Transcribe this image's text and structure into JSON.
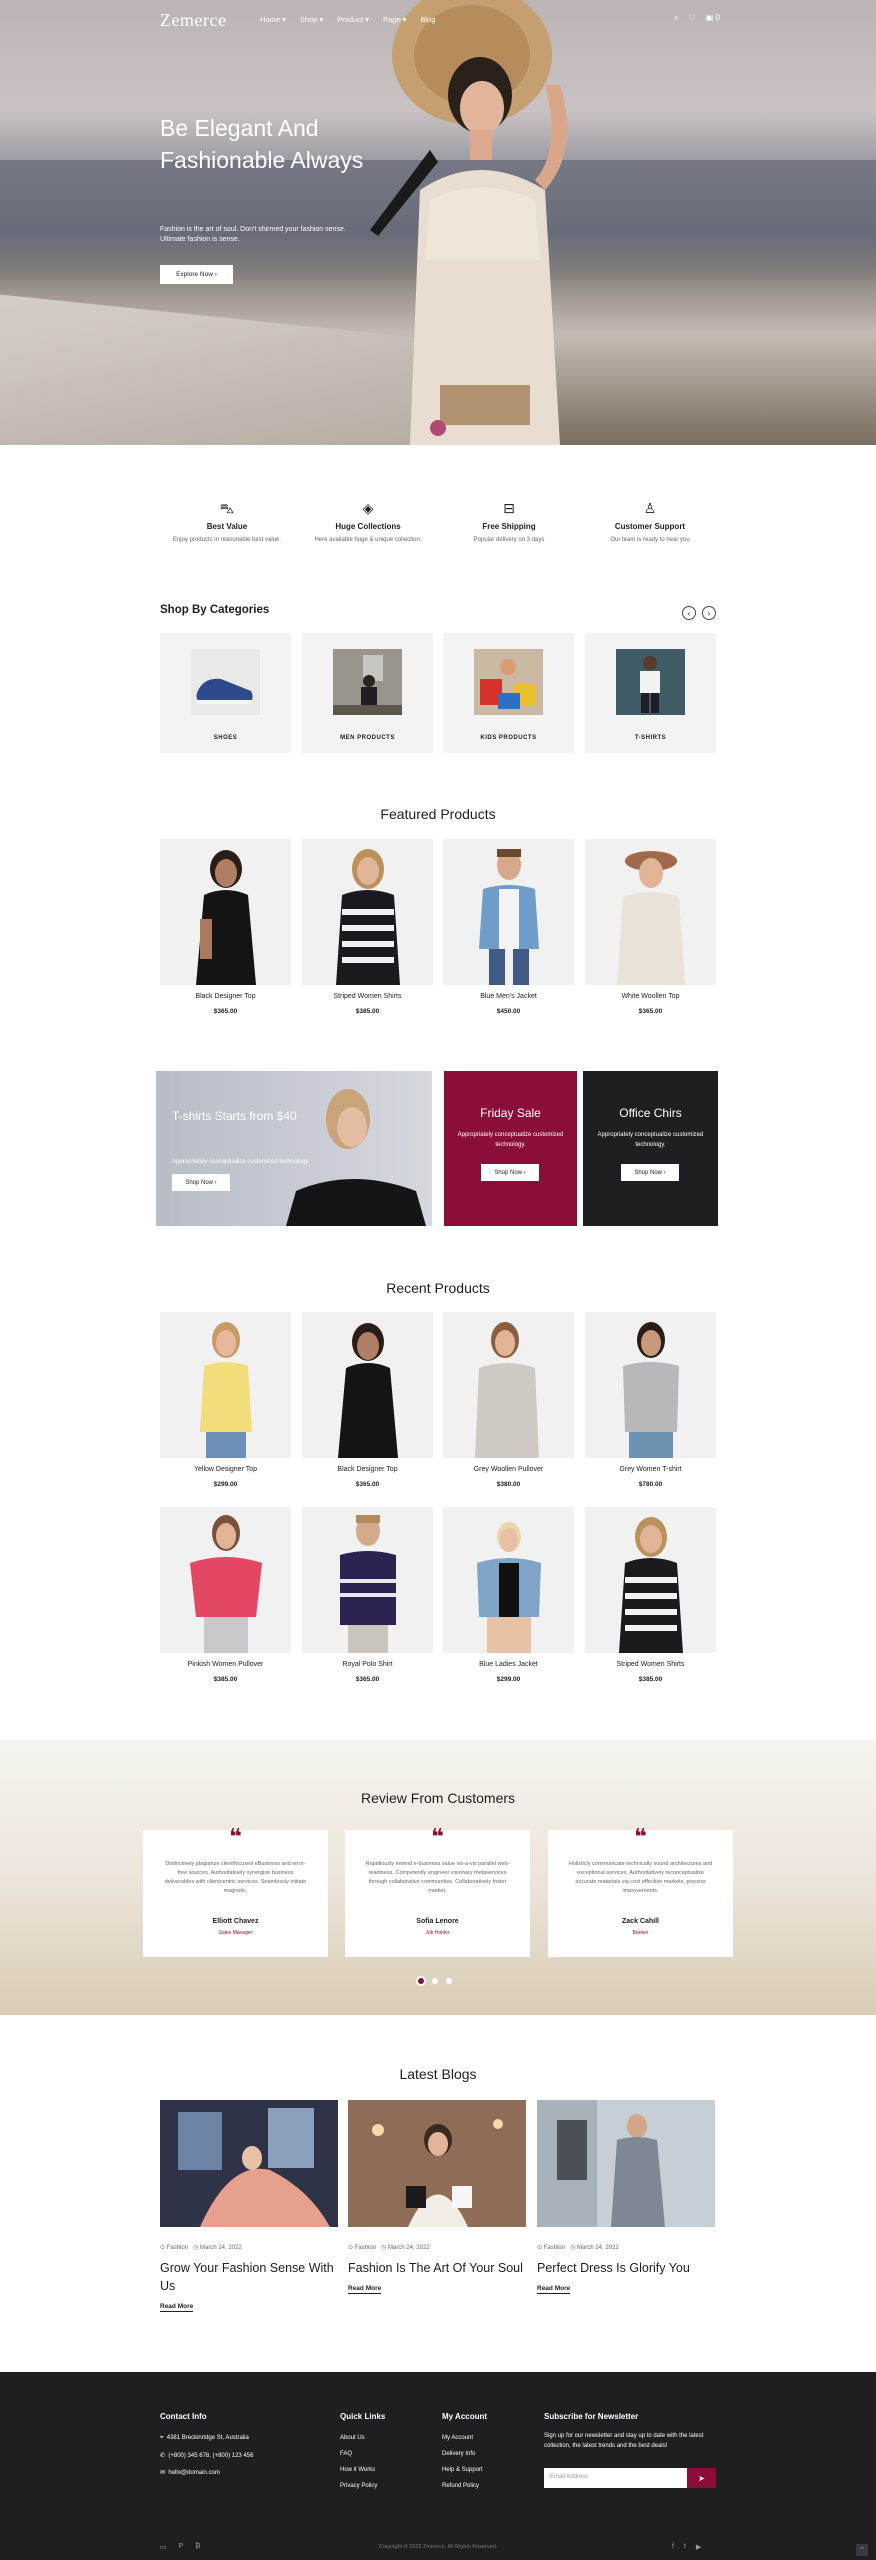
{
  "header": {
    "logo": "Zemerce",
    "nav": [
      "Home",
      "Shop",
      "Product",
      "Page",
      "Blog"
    ],
    "icons": [
      "search-icon",
      "heart-icon",
      "cart-icon"
    ],
    "cart_count": "0"
  },
  "hero": {
    "title": "Be Elegant And Fashionable Always",
    "subtitle": "Fashion is the art of soul. Don't shirmed your fashion sense. Ultimate fashion is sense.",
    "button": "Explore Now"
  },
  "features": [
    {
      "icon": "basket-icon",
      "title": "Best Value",
      "desc": "Enjoy products in reasonable best value."
    },
    {
      "icon": "layers-icon",
      "title": "Huge Collections",
      "desc": "Here available huge & unique collection."
    },
    {
      "icon": "bag-icon",
      "title": "Free Shipping",
      "desc": "Popular delivery on 3 days"
    },
    {
      "icon": "user-icon",
      "title": "Customer Support",
      "desc": "Our team is ready to hear you"
    }
  ],
  "categories": {
    "title": "Shop By Categories",
    "items": [
      "SHOES",
      "MEN PRODUCTS",
      "KIDS PRODUCTS",
      "T-SHIRTS"
    ]
  },
  "featured": {
    "title": "Featured Products",
    "items": [
      {
        "name": "Black Designer Top",
        "price": "$365.00"
      },
      {
        "name": "Striped Women Shirts",
        "price": "$385.00"
      },
      {
        "name": "Blue Men's Jacket",
        "price": "$450.00"
      },
      {
        "name": "White Woollen Top",
        "price": "$365.00"
      }
    ]
  },
  "banners": [
    {
      "title": "T-shirts Starts from $40",
      "text": "Appropriately conceptualize customized technology.",
      "button": "Shop Now"
    },
    {
      "title": "Friday Sale",
      "text": "Appropriately conceptualize customized technology.",
      "button": "Shop Now"
    },
    {
      "title": "Office Chirs",
      "text": "Appropriately conceptualize customized technology.",
      "button": "Shop Now"
    }
  ],
  "recent": {
    "title": "Recent Products",
    "items": [
      {
        "name": "Yellow Designer Top",
        "price": "$299.00"
      },
      {
        "name": "Black Designer Top",
        "price": "$365.00"
      },
      {
        "name": "Grey Woollen Pullover",
        "price": "$380.00"
      },
      {
        "name": "Grey Women T-shirt",
        "price": "$780.00"
      },
      {
        "name": "Pinkish Women Pullover",
        "price": "$385.00"
      },
      {
        "name": "Royal Polo Shirt",
        "price": "$365.00"
      },
      {
        "name": "Blue Ladies Jacket",
        "price": "$299.00"
      },
      {
        "name": "Striped Women Shirts",
        "price": "$385.00"
      }
    ]
  },
  "reviews": {
    "title": "Review From Customers",
    "items": [
      {
        "text": "Distinctively plagiarize clientfocused eBusiness and error-free sources. Authoritatively synergize business deliverables with clientcentric services. Seamlessly initiate magnetic.",
        "name": "Elliott Chavez",
        "role": "Sales Manager"
      },
      {
        "text": "Rapidiously extend e-business value vis-a-vis parallel web-readiness. Competently engineer visionary metaservices through collaborative communities. Collaboratively foster market.",
        "name": "Sofia Lenore",
        "role": "Job Holder"
      },
      {
        "text": "Holisticly communicate technically sound architectures and exceptional services. Authoritatively reconceptualize accurate materials via cost effective markets, process improvements.",
        "name": "Zack Cahill",
        "role": "Banker"
      }
    ]
  },
  "blogs": {
    "title": "Latest Blogs",
    "items": [
      {
        "cat": "Fashion",
        "date": "March 24, 2022",
        "title": "Grow Your Fashion Sense With Us",
        "more": "Read More"
      },
      {
        "cat": "Fashion",
        "date": "March 24, 2022",
        "title": "Fashion Is The Art Of Your Soul",
        "more": "Read More"
      },
      {
        "cat": "Fashion",
        "date": "March 24, 2022",
        "title": "Perfect Dress Is Glorify You",
        "more": "Read More"
      }
    ]
  },
  "footer": {
    "contact": {
      "title": "Contact Info",
      "address": "4381 Breckinridge St, Australia",
      "phone": "(+800) 345 678, (+800) 123 456",
      "email": "hello@domain.com"
    },
    "links": {
      "title": "Quick Links",
      "items": [
        "About Us",
        "FAQ",
        "How it Works",
        "Privacy Policy"
      ]
    },
    "account": {
      "title": "My Account",
      "items": [
        "My Account",
        "Delivery Info",
        "Help & Support",
        "Refund Policy"
      ]
    },
    "newsletter": {
      "title": "Subscribe for Newsletter",
      "text": "Sign up for our newsletter and stay up to date with the latest collection, the latest trends and the best deals!",
      "placeholder": "Email Address",
      "button": "➤"
    },
    "copyright": "Copyright © 2022 Zemerce. All Rights Reserved."
  }
}
